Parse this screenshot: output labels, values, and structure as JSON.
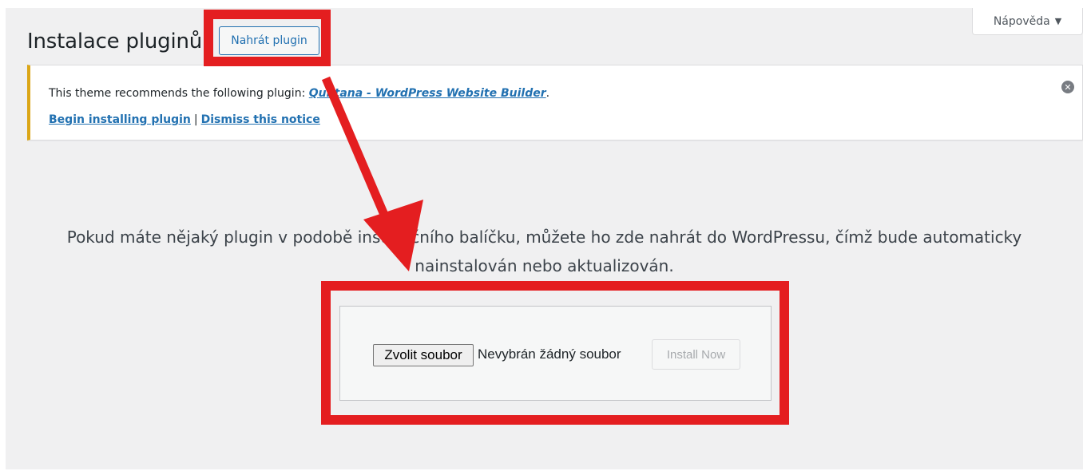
{
  "header": {
    "title": "Instalace pluginů",
    "upload_button": "Nahrát plugin",
    "help_tab": "Nápověda",
    "help_caret": "▼"
  },
  "notice": {
    "text_prefix": "This theme recommends the following plugin: ",
    "plugin_link": "Qubtana - WordPress Website Builder",
    "text_suffix": ".",
    "begin_link": "Begin installing plugin",
    "separator": "|",
    "dismiss_link": "Dismiss this notice",
    "close_glyph": "✕"
  },
  "upload": {
    "description": "Pokud máte nějaký plugin v podobě instalačního balíčku, můžete ho zde nahrát do WordPressu, čímž bude automaticky nainstalován nebo aktualizován.",
    "choose_file_button": "Zvolit soubor",
    "file_status": "Nevybrán žádný soubor",
    "install_button": "Install Now"
  },
  "colors": {
    "annotation_red": "#e41e20",
    "notice_warning": "#dba617",
    "link_blue": "#2271b1"
  },
  "icons": {
    "notice_dismiss": "dismiss-circle-icon",
    "help_dropdown": "caret-down-icon"
  }
}
